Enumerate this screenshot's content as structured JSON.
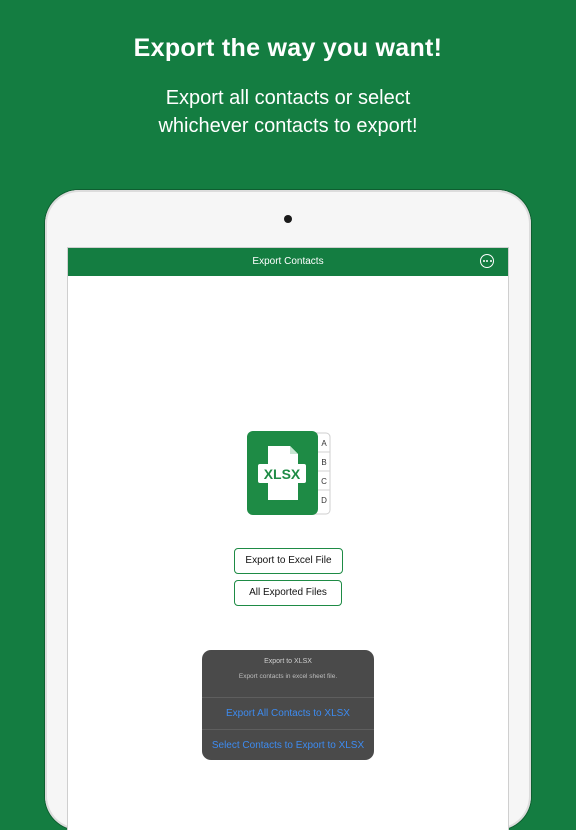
{
  "promo": {
    "headline": "Export the way you want!",
    "subtitle_line1": "Export all contacts or select",
    "subtitle_line2": "whichever contacts to export!"
  },
  "navbar": {
    "title": "Export Contacts",
    "more_icon": "ellipsis-circle-icon"
  },
  "app_icon": {
    "label": "XLSX",
    "tabs": [
      "A",
      "B",
      "C",
      "D"
    ]
  },
  "buttons": {
    "export_label": "Export to Excel File",
    "files_label": "All Exported Files"
  },
  "action_sheet": {
    "title": "Export to XLSX",
    "message": "Export contacts in excel sheet file.",
    "action_all": "Export All Contacts to XLSX",
    "action_select": "Select Contacts to Export to XLSX"
  },
  "colors": {
    "brand_green": "#147d41",
    "action_blue": "#3d8bf0",
    "sheet_bg": "#4a4a4a"
  }
}
